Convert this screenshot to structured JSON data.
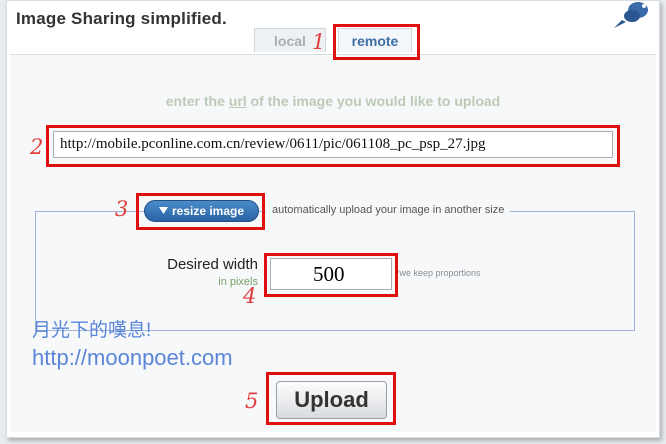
{
  "app": {
    "title": "Image Sharing simplified."
  },
  "tabs": [
    {
      "label": "local",
      "active": false
    },
    {
      "label": "remote",
      "active": true
    }
  ],
  "form": {
    "prompt_before": "enter the ",
    "prompt_url_word": "url",
    "prompt_after": " of the image you would like to upload",
    "url_value": "http://mobile.pconline.com.cn/review/0611/pic/061108_pc_psp_27.jpg",
    "resize_button_label": "resize image",
    "resize_description": "automatically upload your image in another size",
    "width_label": "Desired width",
    "width_unit": "in pixels",
    "width_value": "500",
    "proportions_note": "*we keep proportions",
    "upload_button_label": "Upload"
  },
  "watermark": {
    "line1": "月光下的嘆息!",
    "line2": "http://moonpoet.com"
  },
  "annotations": [
    "1",
    "2",
    "3",
    "4",
    "5"
  ],
  "colors": {
    "callout": "#e01010",
    "number": "#e23b3b",
    "accent_blue": "#2a63a4",
    "watermark": "#5b86d8"
  },
  "icons": {
    "resize_toggle": "triangle-down-icon",
    "logo": "bird-logo-icon"
  }
}
